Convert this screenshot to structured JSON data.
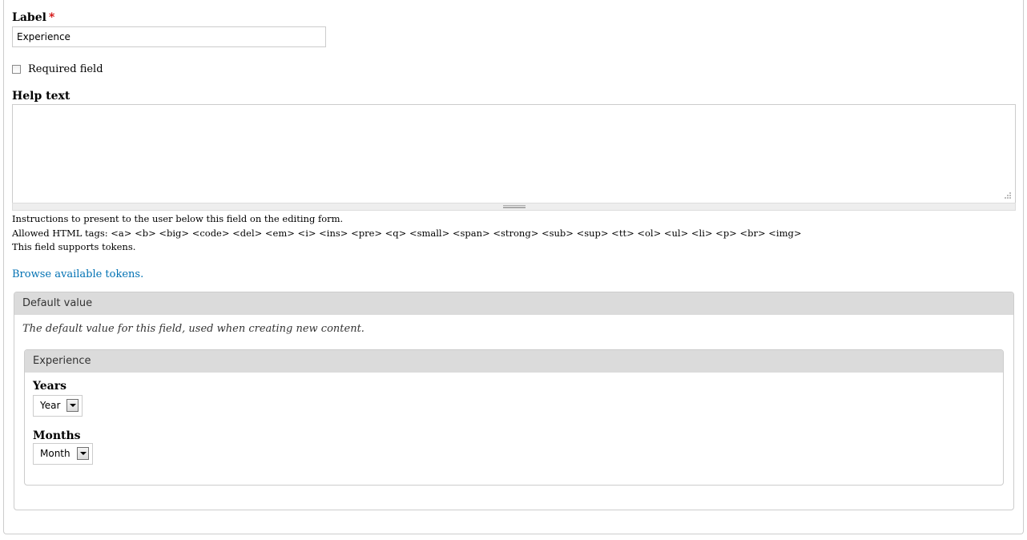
{
  "label_field": {
    "label": "Label",
    "required_mark": "*",
    "value": "Experience"
  },
  "required_field": {
    "label": "Required field",
    "checked": false
  },
  "help_text": {
    "label": "Help text",
    "value": "",
    "description_line1": "Instructions to present to the user below this field on the editing form.",
    "description_line2": "Allowed HTML tags: <a> <b> <big> <code> <del> <em> <i> <ins> <pre> <q> <small> <span> <strong> <sub> <sup> <tt> <ol> <ul> <li> <p> <br> <img>",
    "description_line3": "This field supports tokens."
  },
  "tokens_link": "Browse available tokens.",
  "default_value": {
    "legend": "Default value",
    "description": "The default value for this field, used when creating new content.",
    "inner_fieldset": {
      "legend": "Experience",
      "years": {
        "label": "Years",
        "selected": "Year"
      },
      "months": {
        "label": "Months",
        "selected": "Month"
      }
    }
  },
  "colors": {
    "link": "#0071b3",
    "required": "#d00000",
    "legend_bg": "#dbdbdb"
  }
}
